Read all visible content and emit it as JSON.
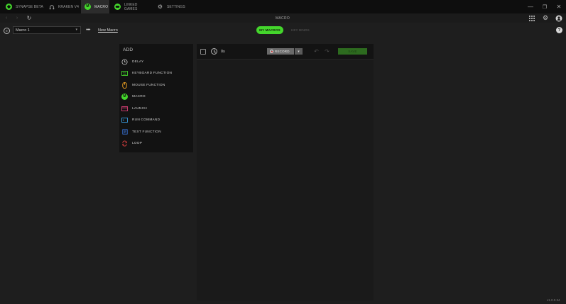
{
  "titlebar": {
    "tabs": [
      {
        "label": "SYNAPSE BETA",
        "icon": "razer-logo-icon",
        "active": false
      },
      {
        "label": "KRAKEN V4",
        "icon": "headset-icon",
        "active": false
      },
      {
        "label": "MACRO",
        "icon": "macro-icon",
        "active": true
      },
      {
        "label": "LINKED GAMES",
        "icon": "gamepad-icon",
        "active": false
      },
      {
        "label": "SETTINGS",
        "icon": "gear-icon",
        "active": false
      }
    ],
    "window_controls": {
      "minimize": "—",
      "maximize": "❐",
      "close": "✕"
    }
  },
  "appbar": {
    "title": "MACRO",
    "back": "‹",
    "forward": "›",
    "refresh": "↻"
  },
  "toolbar": {
    "selected_macro": "Macro 1",
    "more": "•••",
    "new_macro": "New Macro",
    "tab_my_macros": "MY MACROS",
    "tab_key_binds": "KEY BINDS",
    "help": "?"
  },
  "add_panel": {
    "title": "ADD",
    "items": [
      {
        "label": "DELAY",
        "icon": "clock-icon",
        "color": "#b5b5b5"
      },
      {
        "label": "KEYBOARD FUNCTION",
        "icon": "keyboard-icon",
        "color": "#44d62c"
      },
      {
        "label": "MOUSE FUNCTION",
        "icon": "mouse-icon",
        "color": "#f5a623"
      },
      {
        "label": "MACRO",
        "icon": "macro-icon",
        "color": "#44d62c"
      },
      {
        "label": "LAUNCH",
        "icon": "launch-icon",
        "color": "#e0407a"
      },
      {
        "label": "RUN COMMAND",
        "icon": "terminal-icon",
        "color": "#3aa0e8"
      },
      {
        "label": "TEXT FUNCTION",
        "icon": "text-icon",
        "color": "#3a7be8"
      },
      {
        "label": "LOOP",
        "icon": "loop-icon",
        "color": "#e04040"
      }
    ]
  },
  "editor": {
    "duration": "0s",
    "record_label": "RECORD",
    "save_label": "SAVE"
  },
  "footer": {
    "version": "v1.0.0.34"
  },
  "colors": {
    "accent": "#44d62c",
    "background": "#1e1e1e",
    "panel": "#121212"
  }
}
